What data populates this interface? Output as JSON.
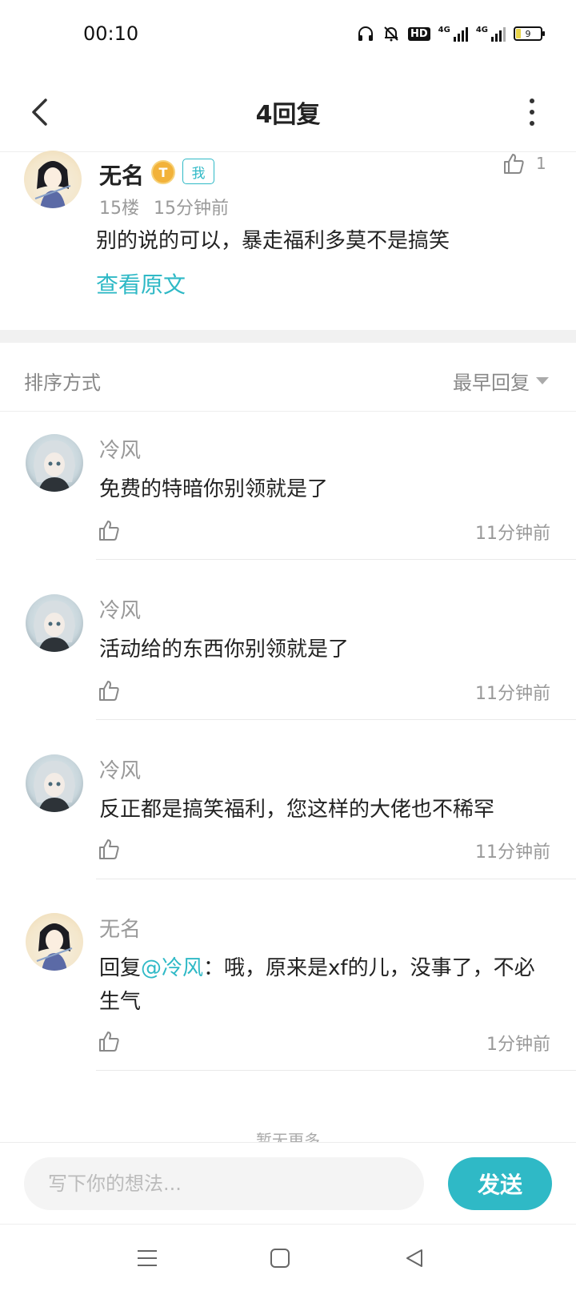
{
  "status_bar": {
    "time": "00:10",
    "hd_label": "HD",
    "net1": "4G",
    "net2": "4G",
    "battery_level": "9"
  },
  "header": {
    "title": "4回复",
    "back_icon": "chevron-left-icon",
    "more_icon": "more-vertical-icon"
  },
  "main_post": {
    "author": "无名",
    "level_badge": "T",
    "me_badge": "我",
    "floor": "15楼",
    "time": "15分钟前",
    "content": "别的说的可以，暴走福利多莫不是搞笑",
    "view_original": "查看原文",
    "like_count": "1"
  },
  "sort": {
    "label": "排序方式",
    "selected": "最早回复"
  },
  "replies": [
    {
      "author": "冷风",
      "content": "免费的特暗你别领就是了",
      "time": "11分钟前"
    },
    {
      "author": "冷风",
      "content": "活动给的东西你别领就是了",
      "time": "11分钟前"
    },
    {
      "author": "冷风",
      "content": "反正都是搞笑福利，您这样的大佬也不稀罕",
      "time": "11分钟前"
    },
    {
      "author": "无名",
      "reply_prefix": "回复",
      "mention": "@冷风",
      "content": "：哦，原来是xf的儿，没事了，不必生气",
      "time": "1分钟前"
    }
  ],
  "footer_hint": "暂无更多",
  "input": {
    "placeholder": "写下你的想法...",
    "value": "",
    "send_label": "发送"
  },
  "colors": {
    "accent": "#2fb9c6",
    "badge_gold": "#f2b23a"
  }
}
